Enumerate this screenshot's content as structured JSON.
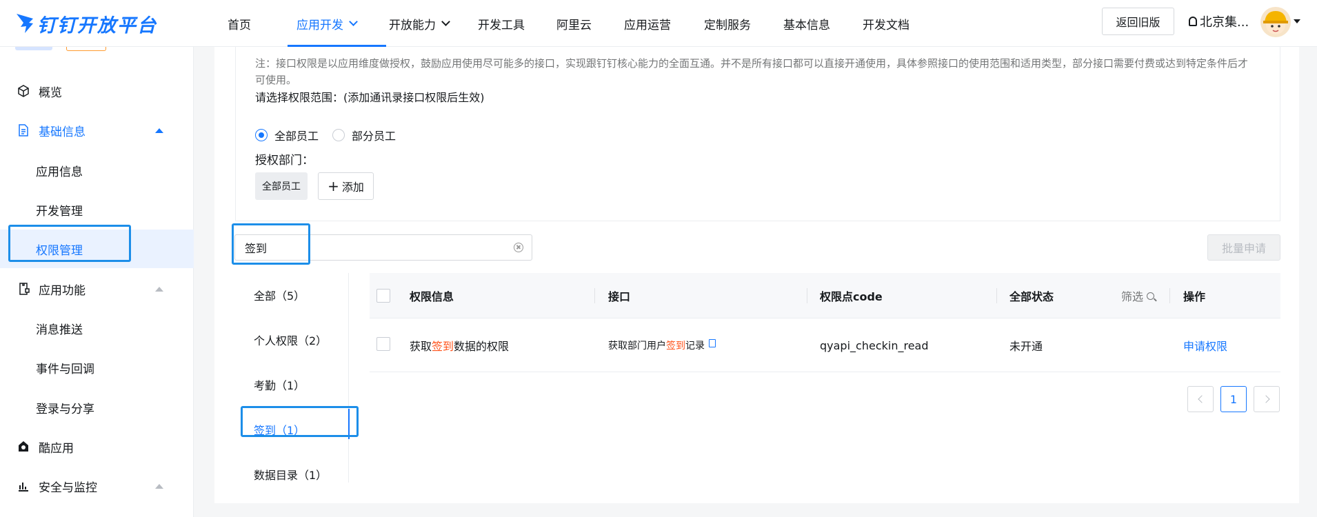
{
  "header": {
    "logo_text": "钉钉开放平台",
    "nav": [
      {
        "label": "首页",
        "dropdown": false,
        "active": false
      },
      {
        "label": "应用开发",
        "dropdown": true,
        "active": true
      },
      {
        "label": "开放能力",
        "dropdown": true,
        "active": false
      },
      {
        "label": "开发工具",
        "dropdown": false,
        "active": false
      },
      {
        "label": "阿里云",
        "dropdown": false,
        "active": false
      },
      {
        "label": "应用运营",
        "dropdown": false,
        "active": false
      },
      {
        "label": "定制服务",
        "dropdown": false,
        "active": false
      },
      {
        "label": "基本信息",
        "dropdown": false,
        "active": false
      },
      {
        "label": "开发文档",
        "dropdown": false,
        "active": false
      }
    ],
    "old_version_label": "返回旧版",
    "org_name": "北京集..."
  },
  "sidebar": {
    "items": [
      {
        "label": "概览",
        "icon": "cube-icon"
      },
      {
        "label": "基础信息",
        "icon": "document-icon",
        "expanded": true
      },
      {
        "label": "应用信息"
      },
      {
        "label": "开发管理"
      },
      {
        "label": "权限管理",
        "selected": true
      },
      {
        "label": "应用功能",
        "icon": "app-function-icon"
      },
      {
        "label": "消息推送"
      },
      {
        "label": "事件与回调"
      },
      {
        "label": "登录与分享"
      },
      {
        "label": "酷应用",
        "icon": "cool-app-icon"
      },
      {
        "label": "安全与监控",
        "icon": "bar-chart-icon"
      }
    ]
  },
  "scope": {
    "note": "注：接口权限是以应用维度做授权，鼓励应用使用尽可能多的接口，实现跟钉钉核心能力的全面互通。并不是所有接口都可以直接开通使用，具体参照接口的使用范围和适用类型，部分接口需要付费或达到特定条件后才可使用。",
    "select_label": "请选择权限范围：(添加通讯录接口权限后生效)",
    "radio_all": "全部员工",
    "radio_part": "部分员工",
    "dept_label": "授权部门：",
    "dept_tag": "全部员工",
    "add_label": "添加"
  },
  "search": {
    "value": "签到"
  },
  "batch_label": "批量申请",
  "categories": [
    {
      "label": "全部（5）"
    },
    {
      "label": "个人权限（2）"
    },
    {
      "label": "考勤（1）"
    },
    {
      "label": "签到（1）",
      "active": true
    },
    {
      "label": "数据目录（1）"
    }
  ],
  "table": {
    "headers": {
      "info": "权限信息",
      "api": "接口",
      "code": "权限点code",
      "status": "全部状态",
      "filter": "筛选",
      "action": "操作"
    },
    "rows": [
      {
        "info_pre": "获取",
        "info_hl": "签到",
        "info_post": "数据的权限",
        "api_pre": "获取部门用户",
        "api_hl": "签到",
        "api_post": "记录",
        "code": "qyapi_checkin_read",
        "status": "未开通",
        "action": "申请权限"
      }
    ]
  },
  "pagination": {
    "current": "1"
  }
}
